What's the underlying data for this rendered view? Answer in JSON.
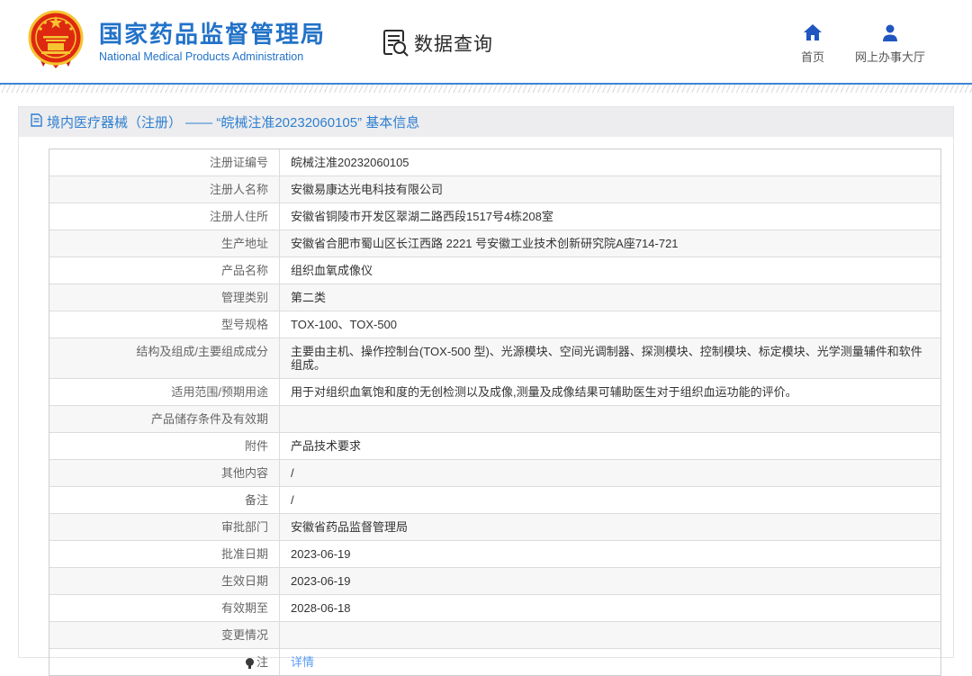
{
  "header": {
    "brand": {
      "title": "国家药品监督管理局",
      "subtitle": "National Medical Products Administration"
    },
    "section": {
      "label": "数据查询",
      "icon": "doc-magnifier-icon"
    },
    "nav": [
      {
        "label": "首页",
        "icon": "home-icon"
      },
      {
        "label": "网上办事大厅",
        "icon": "user-icon"
      }
    ]
  },
  "panel": {
    "title": "境内医疗器械（注册） —— “皖械注准20232060105” 基本信息",
    "title_icon": "document-icon"
  },
  "table": {
    "rows": [
      {
        "label": "注册证编号",
        "value": "皖械注准20232060105"
      },
      {
        "label": "注册人名称",
        "value": "安徽易康达光电科技有限公司"
      },
      {
        "label": "注册人住所",
        "value": "安徽省铜陵市开发区翠湖二路西段1517号4栋208室"
      },
      {
        "label": "生产地址",
        "value": "安徽省合肥市蜀山区长江西路 2221 号安徽工业技术创新研究院A座714-721"
      },
      {
        "label": "产品名称",
        "value": "组织血氧成像仪"
      },
      {
        "label": "管理类别",
        "value": "第二类"
      },
      {
        "label": "型号规格",
        "value": "TOX-100、TOX-500"
      },
      {
        "label": "结构及组成/主要组成成分",
        "value": "主要由主机、操作控制台(TOX-500 型)、光源模块、空间光调制器、探测模块、控制模块、标定模块、光学测量辅件和软件组成。"
      },
      {
        "label": "适用范围/预期用途",
        "value": "用于对组织血氧饱和度的无创检测以及成像,测量及成像结果可辅助医生对于组织血运功能的评价。"
      },
      {
        "label": "产品储存条件及有效期",
        "value": ""
      },
      {
        "label": "附件",
        "value": "产品技术要求"
      },
      {
        "label": "其他内容",
        "value": "/"
      },
      {
        "label": "备注",
        "value": "/"
      },
      {
        "label": "审批部门",
        "value": "安徽省药品监督管理局"
      },
      {
        "label": "批准日期",
        "value": "2023-06-19"
      },
      {
        "label": "生效日期",
        "value": "2023-06-19"
      },
      {
        "label": "有效期至",
        "value": "2028-06-18"
      },
      {
        "label": "变更情况",
        "value": ""
      },
      {
        "label": "注",
        "label_icon": "bulb-icon",
        "value": "详情",
        "link": true
      }
    ]
  },
  "colors": {
    "brand_blue": "#2272c8",
    "panel_title_blue": "#2e7fd0",
    "link_blue": "#5a9cf8",
    "nav_icon_blue": "#2056c0",
    "divider_blue": "#3f85d6",
    "emblem_red": "#de2910",
    "emblem_gold": "#f6c431",
    "row_alt_bg": "#f7f7f8",
    "panel_header_bg": "#ededef"
  }
}
